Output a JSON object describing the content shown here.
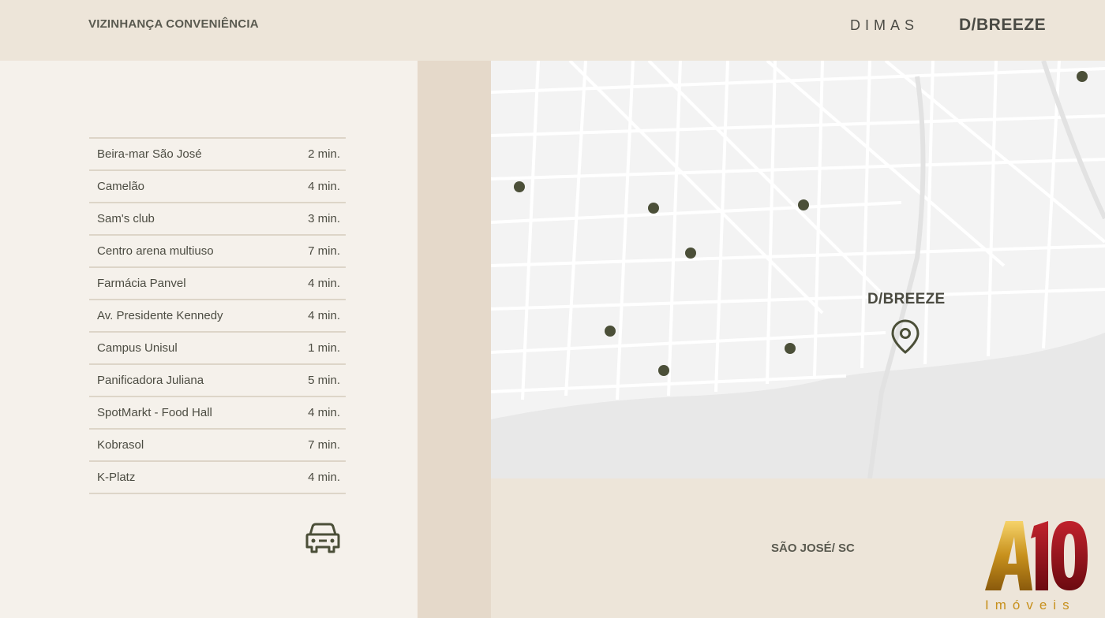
{
  "header": {
    "title": "VIZINHANÇA CONVENIÊNCIA",
    "brand_dimas": "DIMAS",
    "brand_breeze": "D/BREEZE"
  },
  "places": [
    {
      "name": "Beira-mar São José",
      "time": "2 min."
    },
    {
      "name": "Camelão",
      "time": "4 min."
    },
    {
      "name": "Sam's club",
      "time": "3 min."
    },
    {
      "name": "Centro arena multiuso",
      "time": "7 min."
    },
    {
      "name": "Farmácia Panvel",
      "time": "4 min."
    },
    {
      "name": "Av. Presidente Kennedy",
      "time": "4 min."
    },
    {
      "name": "Campus Unisul",
      "time": "1 min."
    },
    {
      "name": "Panificadora Juliana",
      "time": "5 min."
    },
    {
      "name": "SpotMarkt - Food Hall",
      "time": "4 min."
    },
    {
      "name": "Kobrasol",
      "time": "7 min."
    },
    {
      "name": "K-Platz",
      "time": "4 min."
    }
  ],
  "map": {
    "label": "D/BREEZE",
    "marker_color": "#4b4f38"
  },
  "footer": {
    "city": "SÃO JOSÉ/ SC",
    "logo_text": "A10",
    "logo_sub": "Imóveis"
  },
  "icons": [
    "car-icon",
    "location-pin-icon"
  ]
}
